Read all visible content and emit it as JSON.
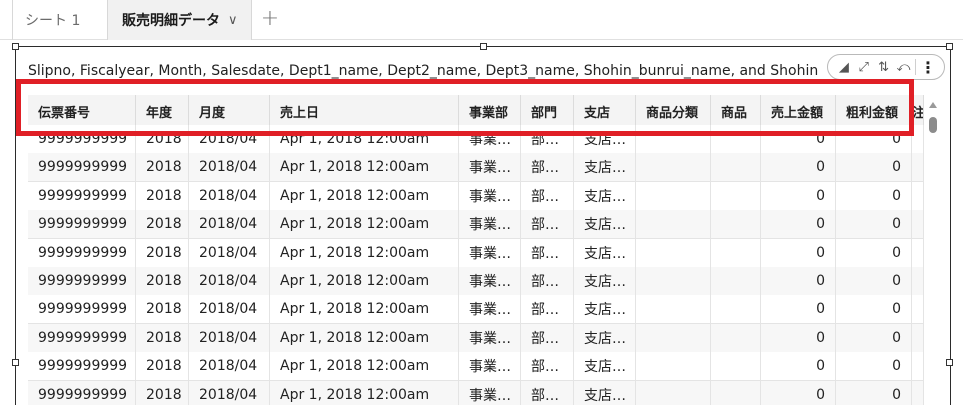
{
  "tabs": [
    {
      "label": "シート 1"
    },
    {
      "label": "販売明細データ",
      "chevron": "∨"
    }
  ],
  "add_tab_label": "+",
  "visual": {
    "title": "Slipno, Fiscalyear, Month, Salesdate, Dept1_name, Dept2_name, Dept3_name, Shohin_bunrui_name, and Shohin",
    "toolbar": {
      "icons": [
        "visual-type-icon",
        "expand-icon",
        "sort-icon",
        "drill-icon"
      ],
      "glyphs": {
        "visual_type": "◢",
        "expand": "⤢",
        "sort": "⇅",
        "drill": "⤺",
        "menu": "⋮"
      }
    }
  },
  "table": {
    "columns": [
      "伝票番号",
      "年度",
      "月度",
      "売上日",
      "事業部",
      "部門",
      "支店",
      "商品分類",
      "商品",
      "売上金額",
      "粗利金額",
      "注"
    ],
    "rows": [
      [
        "9999999999",
        "2018",
        "2018/04",
        "Apr 1, 2018 12:00am",
        "事業…",
        "部…",
        "支店…",
        "",
        "",
        "0",
        "0"
      ],
      [
        "9999999999",
        "2018",
        "2018/04",
        "Apr 1, 2018 12:00am",
        "事業…",
        "部…",
        "支店…",
        "",
        "",
        "0",
        "0"
      ],
      [
        "9999999999",
        "2018",
        "2018/04",
        "Apr 1, 2018 12:00am",
        "事業…",
        "部…",
        "支店…",
        "",
        "",
        "0",
        "0"
      ],
      [
        "9999999999",
        "2018",
        "2018/04",
        "Apr 1, 2018 12:00am",
        "事業…",
        "部…",
        "支店…",
        "",
        "",
        "0",
        "0"
      ],
      [
        "9999999999",
        "2018",
        "2018/04",
        "Apr 1, 2018 12:00am",
        "事業…",
        "部…",
        "支店…",
        "",
        "",
        "0",
        "0"
      ],
      [
        "9999999999",
        "2018",
        "2018/04",
        "Apr 1, 2018 12:00am",
        "事業…",
        "部…",
        "支店…",
        "",
        "",
        "0",
        "0"
      ],
      [
        "9999999999",
        "2018",
        "2018/04",
        "Apr 1, 2018 12:00am",
        "事業…",
        "部…",
        "支店…",
        "",
        "",
        "0",
        "0"
      ],
      [
        "9999999999",
        "2018",
        "2018/04",
        "Apr 1, 2018 12:00am",
        "事業…",
        "部…",
        "支店…",
        "",
        "",
        "0",
        "0"
      ],
      [
        "9999999999",
        "2018",
        "2018/04",
        "Apr 1, 2018 12:00am",
        "事業…",
        "部…",
        "支店…",
        "",
        "",
        "0",
        "0"
      ],
      [
        "9999999999",
        "2018",
        "2018/04",
        "Apr 1, 2018 12:00am",
        "事業…",
        "部…",
        "支店…",
        "",
        "",
        "0",
        "0"
      ]
    ]
  },
  "colors": {
    "highlight": "#e01f26",
    "header_bg": "#f4f4f4",
    "active_tab_bg": "#f1f1f1"
  }
}
